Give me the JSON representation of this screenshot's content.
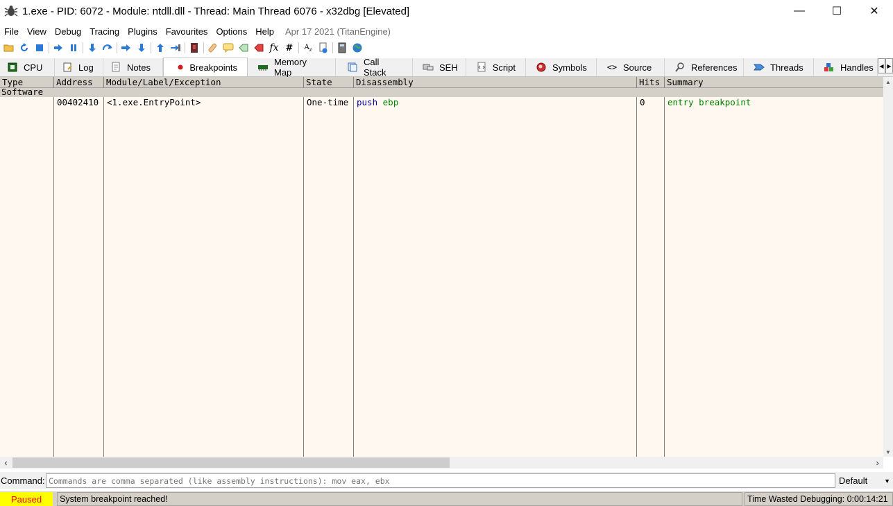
{
  "window": {
    "title": "1.exe - PID: 6072 - Module: ntdll.dll - Thread: Main Thread 6076 - x32dbg [Elevated]",
    "minimize": "—",
    "maximize": "☐",
    "close": "✕"
  },
  "menu": {
    "items": [
      "File",
      "View",
      "Debug",
      "Tracing",
      "Plugins",
      "Favourites",
      "Options",
      "Help"
    ],
    "build_date": "Apr 17 2021 (TitanEngine)"
  },
  "toolbar": {
    "icons": [
      "open-icon",
      "restart-icon",
      "stop-icon",
      "run-icon",
      "pause-icon",
      "step-into-icon",
      "step-over-icon",
      "trace-into-icon",
      "trace-over-icon",
      "execute-till-return-icon",
      "run-to-user-code-icon",
      "scylla-icon",
      "patches-icon",
      "comments-icon",
      "labels-icon",
      "bookmarks-icon",
      "functions-icon",
      "hash-icon",
      "font-icon",
      "help-icon",
      "calculator-icon",
      "globe-icon"
    ]
  },
  "tabs": [
    {
      "label": "CPU",
      "icon": "cpu-icon",
      "active": false
    },
    {
      "label": "Log",
      "icon": "log-icon",
      "active": false
    },
    {
      "label": "Notes",
      "icon": "notes-icon",
      "active": false
    },
    {
      "label": "Breakpoints",
      "icon": "breakpoint-dot-icon",
      "active": true
    },
    {
      "label": "Memory Map",
      "icon": "memory-map-icon",
      "active": false
    },
    {
      "label": "Call Stack",
      "icon": "call-stack-icon",
      "active": false
    },
    {
      "label": "SEH",
      "icon": "seh-icon",
      "active": false
    },
    {
      "label": "Script",
      "icon": "script-icon",
      "active": false
    },
    {
      "label": "Symbols",
      "icon": "symbols-icon",
      "active": false
    },
    {
      "label": "Source",
      "icon": "source-icon",
      "active": false
    },
    {
      "label": "References",
      "icon": "references-icon",
      "active": false
    },
    {
      "label": "Threads",
      "icon": "threads-icon",
      "active": false
    },
    {
      "label": "Handles",
      "icon": "handles-icon",
      "active": false
    }
  ],
  "table": {
    "columns": [
      "Type",
      "Address",
      "Module/Label/Exception",
      "State",
      "Disassembly",
      "Hits",
      "Summary"
    ],
    "group": "Software",
    "rows": [
      {
        "type": "",
        "address": "00402410",
        "module": "<1.exe.EntryPoint>",
        "state": "One-time",
        "disasm_mnemonic": "push",
        "disasm_operand": "ebp",
        "hits": "0",
        "summary": "entry breakpoint"
      }
    ]
  },
  "command": {
    "label": "Command:",
    "placeholder": "Commands are comma separated (like assembly instructions): mov eax, ebx",
    "value": "",
    "mode": "Default"
  },
  "status": {
    "state": "Paused",
    "message": "System breakpoint reached!",
    "time_wasted": "Time Wasted Debugging: 0:00:14:21"
  },
  "colors": {
    "table_background": "#fff8f0",
    "header_background": "#d4d0c8",
    "mnemonic": "#0000a0",
    "operand": "#008000",
    "paused_bg": "#ffff00",
    "paused_text": "#ff0000"
  }
}
